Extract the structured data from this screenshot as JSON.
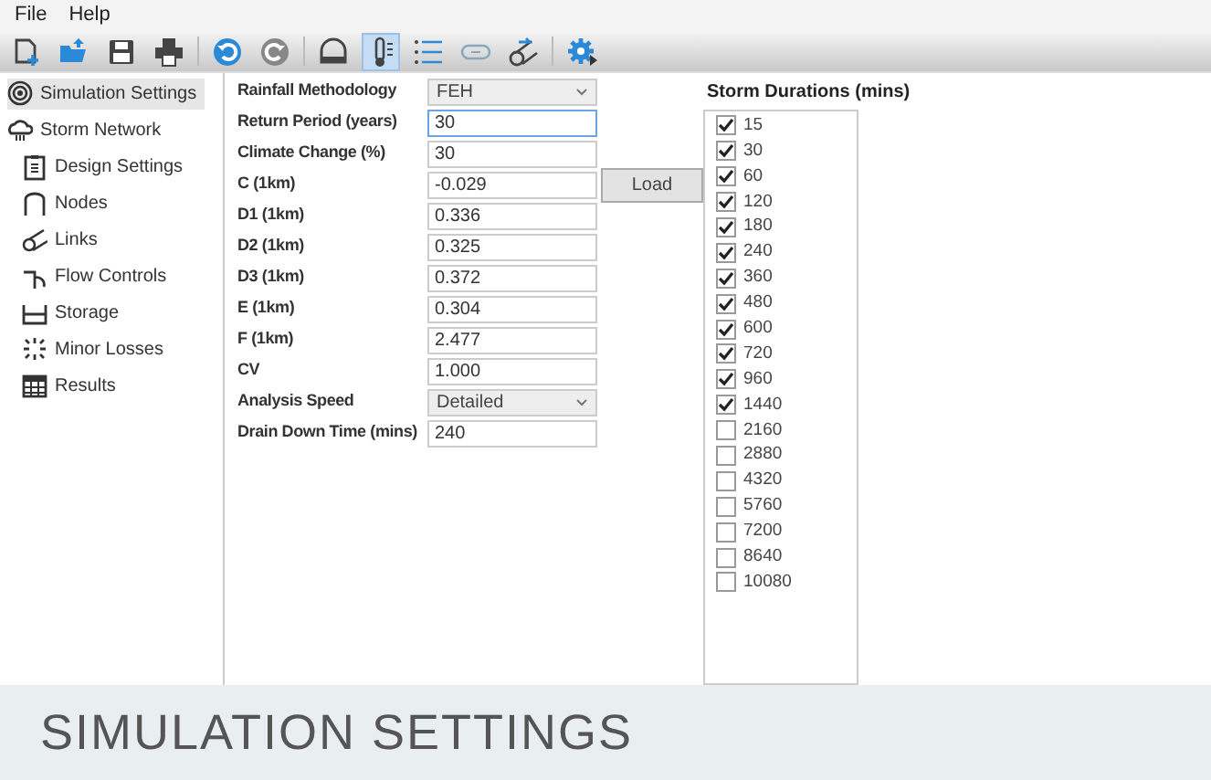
{
  "menu": [
    "File",
    "Help"
  ],
  "toolbar": [
    {
      "selected": false
    },
    {
      "selected": false
    },
    {
      "selected": false
    },
    {
      "selected": false
    },
    {
      "selected": false
    },
    {
      "selected": false
    },
    {
      "selected": false
    },
    {
      "selected": true
    },
    {
      "selected": false
    },
    {
      "selected": false
    },
    {
      "selected": false
    },
    {
      "selected": false
    }
  ],
  "sidebar": {
    "items": [
      {
        "label": "Simulation Settings",
        "selected": true
      },
      {
        "label": "Storm Network",
        "selected": false,
        "children": [
          {
            "label": "Design Settings",
            "selected": false
          },
          {
            "label": "Nodes",
            "selected": false
          },
          {
            "label": "Links",
            "selected": false
          },
          {
            "label": "Flow Controls",
            "selected": false
          },
          {
            "label": "Storage",
            "selected": false
          },
          {
            "label": "Minor Losses",
            "selected": false
          },
          {
            "label": "Results",
            "selected": false
          }
        ]
      }
    ]
  },
  "form": [
    {
      "label": "Rainfall Methodology",
      "kind": "select",
      "value": "FEH"
    },
    {
      "label": "Return Period (years)",
      "kind": "input",
      "value": "30",
      "focused": true
    },
    {
      "label": "Climate Change (%)",
      "kind": "input",
      "value": "30",
      "focused": false
    },
    {
      "label": "C (1km)",
      "kind": "input",
      "value": "-0.029",
      "focused": false,
      "button": "Load"
    },
    {
      "label": "D1 (1km)",
      "kind": "input",
      "value": "0.336",
      "focused": false
    },
    {
      "label": "D2 (1km)",
      "kind": "input",
      "value": "0.325",
      "focused": false
    },
    {
      "label": "D3 (1km)",
      "kind": "input",
      "value": "0.372",
      "focused": false
    },
    {
      "label": "E (1km)",
      "kind": "input",
      "value": "0.304",
      "focused": false
    },
    {
      "label": "F (1km)",
      "kind": "input",
      "value": "2.477",
      "focused": false
    },
    {
      "label": "CV",
      "kind": "input",
      "value": "1.000",
      "focused": false
    },
    {
      "label": "Analysis Speed",
      "kind": "select",
      "value": "Detailed"
    },
    {
      "label": "Drain Down Time (mins)",
      "kind": "input",
      "value": "240",
      "focused": false
    }
  ],
  "storm_durations": {
    "title": "Storm Durations (mins)",
    "items": [
      {
        "label": "15",
        "checked": true
      },
      {
        "label": "30",
        "checked": true
      },
      {
        "label": "60",
        "checked": true
      },
      {
        "label": "120",
        "checked": true
      },
      {
        "label": "180",
        "checked": true
      },
      {
        "label": "240",
        "checked": true
      },
      {
        "label": "360",
        "checked": true
      },
      {
        "label": "480",
        "checked": true
      },
      {
        "label": "600",
        "checked": true
      },
      {
        "label": "720",
        "checked": true
      },
      {
        "label": "960",
        "checked": true
      },
      {
        "label": "1440",
        "checked": true
      },
      {
        "label": "2160",
        "checked": false
      },
      {
        "label": "2880",
        "checked": false
      },
      {
        "label": "4320",
        "checked": false
      },
      {
        "label": "5760",
        "checked": false
      },
      {
        "label": "7200",
        "checked": false
      },
      {
        "label": "8640",
        "checked": false
      },
      {
        "label": "10080",
        "checked": false
      }
    ]
  },
  "caption": "SIMULATION SETTINGS"
}
